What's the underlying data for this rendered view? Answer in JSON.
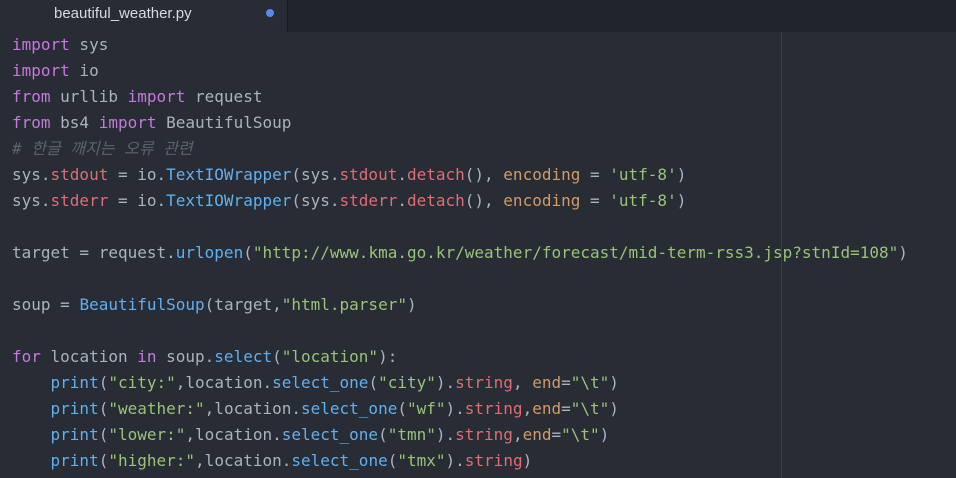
{
  "tab": {
    "title": "beautiful_weather.py",
    "modified": true
  },
  "colors": {
    "background": "#282c34",
    "tabbar": "#21252b",
    "keyword": "#c678dd",
    "function": "#61afef",
    "string": "#98c379",
    "property": "#e06c75",
    "argument": "#d19a66",
    "comment": "#5c6370",
    "plain": "#abb2bf",
    "modified_dot": "#568af2"
  },
  "code_lines": [
    [
      [
        "kw",
        "import"
      ],
      [
        "pl",
        " sys"
      ]
    ],
    [
      [
        "kw",
        "import"
      ],
      [
        "pl",
        " io"
      ]
    ],
    [
      [
        "kw",
        "from"
      ],
      [
        "pl",
        " urllib "
      ],
      [
        "kw",
        "import"
      ],
      [
        "pl",
        " request"
      ]
    ],
    [
      [
        "kw",
        "from"
      ],
      [
        "pl",
        " bs4 "
      ],
      [
        "kw",
        "import"
      ],
      [
        "pl",
        " BeautifulSoup"
      ]
    ],
    [
      [
        "cm",
        "# 한글 깨지는 오류 관련"
      ]
    ],
    [
      [
        "pl",
        "sys."
      ],
      [
        "prop",
        "stdout"
      ],
      [
        "pl",
        " = io."
      ],
      [
        "fn",
        "TextIOWrapper"
      ],
      [
        "pl",
        "(sys."
      ],
      [
        "prop",
        "stdout"
      ],
      [
        "pl",
        "."
      ],
      [
        "prop",
        "detach"
      ],
      [
        "pl",
        "(), "
      ],
      [
        "arg",
        "encoding"
      ],
      [
        "pl",
        " = "
      ],
      [
        "str",
        "'utf-8'"
      ],
      [
        "pl",
        ")"
      ]
    ],
    [
      [
        "pl",
        "sys."
      ],
      [
        "prop",
        "stderr"
      ],
      [
        "pl",
        " = io."
      ],
      [
        "fn",
        "TextIOWrapper"
      ],
      [
        "pl",
        "(sys."
      ],
      [
        "prop",
        "stderr"
      ],
      [
        "pl",
        "."
      ],
      [
        "prop",
        "detach"
      ],
      [
        "pl",
        "(), "
      ],
      [
        "arg",
        "encoding"
      ],
      [
        "pl",
        " = "
      ],
      [
        "str",
        "'utf-8'"
      ],
      [
        "pl",
        ")"
      ]
    ],
    [],
    [
      [
        "pl",
        "target = request."
      ],
      [
        "fn",
        "urlopen"
      ],
      [
        "pl",
        "("
      ],
      [
        "str",
        "\"http://www.kma.go.kr/weather/forecast/mid-term-rss3.jsp?stnId=108\""
      ],
      [
        "pl",
        ")"
      ]
    ],
    [],
    [
      [
        "pl",
        "soup = "
      ],
      [
        "fn",
        "BeautifulSoup"
      ],
      [
        "pl",
        "(target,"
      ],
      [
        "str",
        "\"html.parser\""
      ],
      [
        "pl",
        ")"
      ]
    ],
    [],
    [
      [
        "kw",
        "for"
      ],
      [
        "pl",
        " location "
      ],
      [
        "kw",
        "in"
      ],
      [
        "pl",
        " soup."
      ],
      [
        "fn",
        "select"
      ],
      [
        "pl",
        "("
      ],
      [
        "str",
        "\"location\""
      ],
      [
        "pl",
        "):"
      ]
    ],
    [
      [
        "pl",
        "    "
      ],
      [
        "fn",
        "print"
      ],
      [
        "pl",
        "("
      ],
      [
        "str",
        "\"city:\""
      ],
      [
        "pl",
        ",location."
      ],
      [
        "fn",
        "select_one"
      ],
      [
        "pl",
        "("
      ],
      [
        "str",
        "\"city\""
      ],
      [
        "pl",
        ")."
      ],
      [
        "prop",
        "string"
      ],
      [
        "pl",
        ", "
      ],
      [
        "arg",
        "end"
      ],
      [
        "pl",
        "="
      ],
      [
        "str",
        "\"\\t\""
      ],
      [
        "pl",
        ")"
      ]
    ],
    [
      [
        "pl",
        "    "
      ],
      [
        "fn",
        "print"
      ],
      [
        "pl",
        "("
      ],
      [
        "str",
        "\"weather:\""
      ],
      [
        "pl",
        ",location."
      ],
      [
        "fn",
        "select_one"
      ],
      [
        "pl",
        "("
      ],
      [
        "str",
        "\"wf\""
      ],
      [
        "pl",
        ")."
      ],
      [
        "prop",
        "string"
      ],
      [
        "pl",
        ","
      ],
      [
        "arg",
        "end"
      ],
      [
        "pl",
        "="
      ],
      [
        "str",
        "\"\\t\""
      ],
      [
        "pl",
        ")"
      ]
    ],
    [
      [
        "pl",
        "    "
      ],
      [
        "fn",
        "print"
      ],
      [
        "pl",
        "("
      ],
      [
        "str",
        "\"lower:\""
      ],
      [
        "pl",
        ",location."
      ],
      [
        "fn",
        "select_one"
      ],
      [
        "pl",
        "("
      ],
      [
        "str",
        "\"tmn\""
      ],
      [
        "pl",
        ")."
      ],
      [
        "prop",
        "string"
      ],
      [
        "pl",
        ","
      ],
      [
        "arg",
        "end"
      ],
      [
        "pl",
        "="
      ],
      [
        "str",
        "\"\\t\""
      ],
      [
        "pl",
        ")"
      ]
    ],
    [
      [
        "pl",
        "    "
      ],
      [
        "fn",
        "print"
      ],
      [
        "pl",
        "("
      ],
      [
        "str",
        "\"higher:\""
      ],
      [
        "pl",
        ",location."
      ],
      [
        "fn",
        "select_one"
      ],
      [
        "pl",
        "("
      ],
      [
        "str",
        "\"tmx\""
      ],
      [
        "pl",
        ")."
      ],
      [
        "prop",
        "string"
      ],
      [
        "pl",
        ")"
      ]
    ]
  ]
}
